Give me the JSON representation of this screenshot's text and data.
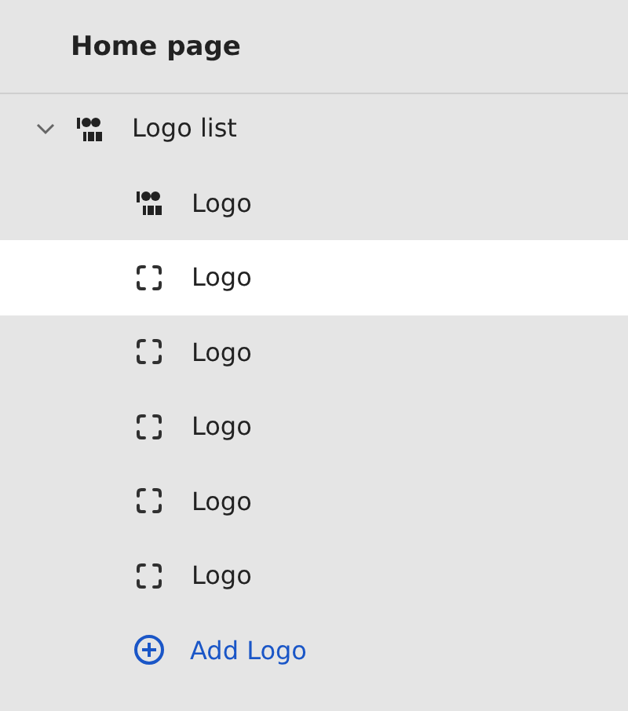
{
  "header": {
    "title": "Home page"
  },
  "tree": {
    "label": "Logo list",
    "expanded": true,
    "children": [
      {
        "label": "Logo",
        "kind": "image",
        "selected": false
      },
      {
        "label": "Logo",
        "kind": "empty",
        "selected": true
      },
      {
        "label": "Logo",
        "kind": "empty",
        "selected": false
      },
      {
        "label": "Logo",
        "kind": "empty",
        "selected": false
      },
      {
        "label": "Logo",
        "kind": "empty",
        "selected": false
      },
      {
        "label": "Logo",
        "kind": "empty",
        "selected": false
      }
    ]
  },
  "add_button": {
    "label": "Add Logo"
  }
}
